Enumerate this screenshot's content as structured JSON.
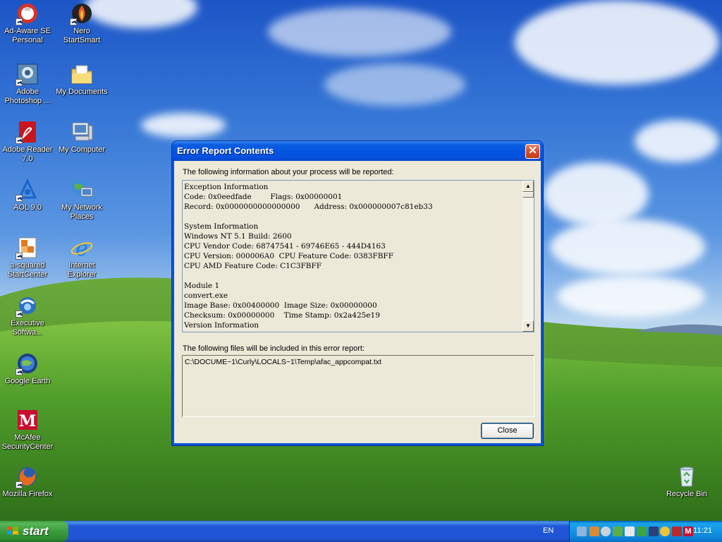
{
  "desktop": {
    "icons": [
      {
        "name": "ad-aware-icon",
        "label": "Ad-Aware SE\nPersonal"
      },
      {
        "name": "nero-icon",
        "label": "Nero\nStartSmart"
      },
      {
        "name": "photoshop-icon",
        "label": "Adobe\nPhotoshop ..."
      },
      {
        "name": "my-documents-icon",
        "label": "My Documents"
      },
      {
        "name": "adobe-reader-icon",
        "label": "Adobe Reader\n7.0"
      },
      {
        "name": "my-computer-icon",
        "label": "My Computer"
      },
      {
        "name": "aol-icon",
        "label": "AOL 9.0"
      },
      {
        "name": "network-places-icon",
        "label": "My Network\nPlaces"
      },
      {
        "name": "a-squared-icon",
        "label": "a-squared\nStartCenter"
      },
      {
        "name": "internet-explorer-icon",
        "label": "Internet\nExplorer"
      },
      {
        "name": "executive-software-icon",
        "label": "Executive\nSoftwa..."
      },
      {
        "name": "google-earth-icon",
        "label": "Google Earth"
      },
      {
        "name": "mcafee-icon",
        "label": "McAfee\nSecurityCenter"
      },
      {
        "name": "firefox-icon",
        "label": "Mozilla Firefox"
      },
      {
        "name": "recycle-bin-icon",
        "label": "Recycle Bin"
      }
    ]
  },
  "dialog": {
    "title": "Error Report Contents",
    "intro_label": "The following information about your process will be reported:",
    "report_lines": [
      "Exception Information",
      "Code: 0x0eedfade        Flags: 0x00000001",
      "Record: 0x0000000000000000      Address: 0x000000007c81eb33",
      "",
      "System Information",
      "Windows NT 5.1 Build: 2600",
      "CPU Vendor Code: 68747541 - 69746E65 - 444D4163",
      "CPU Version: 000006A0  CPU Feature Code: 0383FBFF",
      "CPU AMD Feature Code: C1C3FBFF",
      "",
      "Module 1",
      "convert.exe",
      "Image Base: 0x00400000  Image Size: 0x00000000",
      "Checksum: 0x00000000    Time Stamp: 0x2a425e19",
      "Version Information"
    ],
    "files_label": "The following files will be included in this error report:",
    "files": [
      "C:\\DOCUME~1\\Curly\\LOCALS~1\\Temp\\afac_appcompat.txt"
    ],
    "close_label": "Close",
    "close_glyph": "✕"
  },
  "taskbar": {
    "start_label": "start",
    "language": "EN",
    "clock": "11:21",
    "tray_icons": [
      "network-icon",
      "app-icon",
      "volume-icon",
      "sync-icon",
      "security-icon",
      "printer-icon",
      "update-icon",
      "wireless-icon",
      "antivirus-icon",
      "mcafee-tray-icon"
    ]
  }
}
